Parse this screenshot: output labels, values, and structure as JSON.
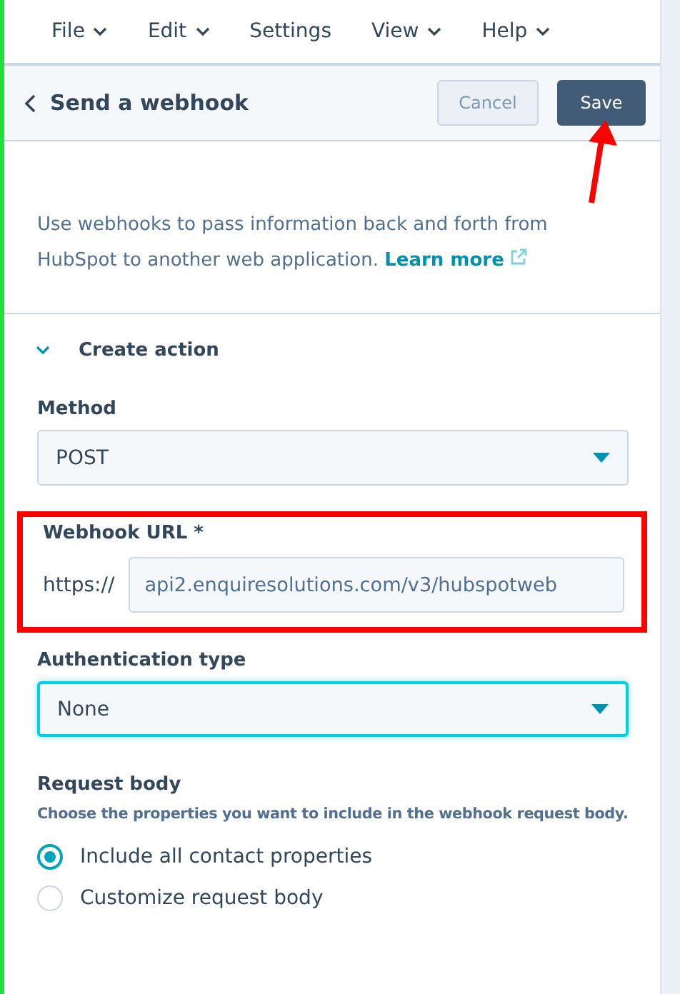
{
  "menu": [
    {
      "label": "File",
      "caret": true
    },
    {
      "label": "Edit",
      "caret": true
    },
    {
      "label": "Settings",
      "caret": false
    },
    {
      "label": "View",
      "caret": true
    },
    {
      "label": "Help",
      "caret": true
    }
  ],
  "header": {
    "title": "Send a webhook",
    "cancel": "Cancel",
    "save": "Save"
  },
  "description": {
    "text": "Use webhooks to pass information back and forth from HubSpot to another web application.",
    "link": "Learn more"
  },
  "section": {
    "title": "Create action",
    "expanded": true
  },
  "method": {
    "label": "Method",
    "value": "POST"
  },
  "webhook_url": {
    "label": "Webhook URL *",
    "prefix": "https://",
    "value": "api2.enquiresolutions.com/v3/hubspotweb",
    "highlighted": true
  },
  "auth": {
    "label": "Authentication type",
    "value": "None",
    "focused": true
  },
  "request_body": {
    "label": "Request body",
    "hint": "Choose the properties you want to include in the webhook request body.",
    "options": [
      {
        "label": "Include all contact properties",
        "selected": true
      },
      {
        "label": "Customize request body",
        "selected": false
      }
    ]
  }
}
